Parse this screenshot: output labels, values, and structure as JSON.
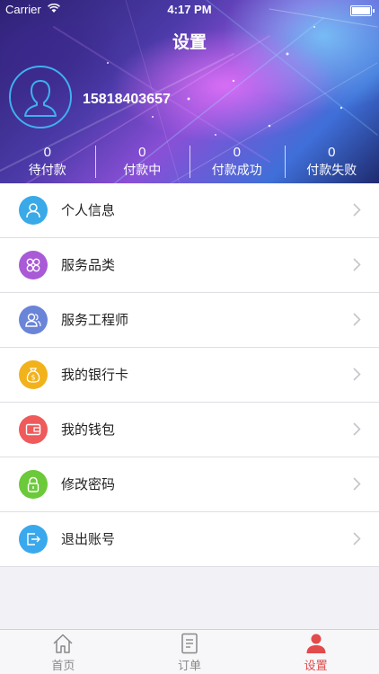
{
  "status_bar": {
    "carrier": "Carrier",
    "time": "4:17 PM"
  },
  "header": {
    "title": "设置",
    "phone": "15818403657"
  },
  "stats": [
    {
      "count": "0",
      "label": "待付款"
    },
    {
      "count": "0",
      "label": "付款中"
    },
    {
      "count": "0",
      "label": "付款成功"
    },
    {
      "count": "0",
      "label": "付款失败"
    }
  ],
  "menu": [
    {
      "label": "个人信息",
      "icon": "person-icon",
      "color": "#39a9e8"
    },
    {
      "label": "服务品类",
      "icon": "categories-icon",
      "color": "#a95ad6"
    },
    {
      "label": "服务工程师",
      "icon": "engineer-icon",
      "color": "#6a84d8"
    },
    {
      "label": "我的银行卡",
      "icon": "money-bag-icon",
      "color": "#f2b21c"
    },
    {
      "label": "我的钱包",
      "icon": "wallet-icon",
      "color": "#ef5a5a"
    },
    {
      "label": "修改密码",
      "icon": "lock-icon",
      "color": "#6cc93a"
    },
    {
      "label": "退出账号",
      "icon": "logout-icon",
      "color": "#3aa8ec"
    }
  ],
  "tabbar": [
    {
      "label": "首页",
      "icon": "home-icon"
    },
    {
      "label": "订单",
      "icon": "orders-icon"
    },
    {
      "label": "设置",
      "icon": "profile-icon"
    }
  ],
  "active_tab": "设置",
  "colors": {
    "accent": "#e24b4b",
    "avatar_ring": "#3fb0f0"
  }
}
